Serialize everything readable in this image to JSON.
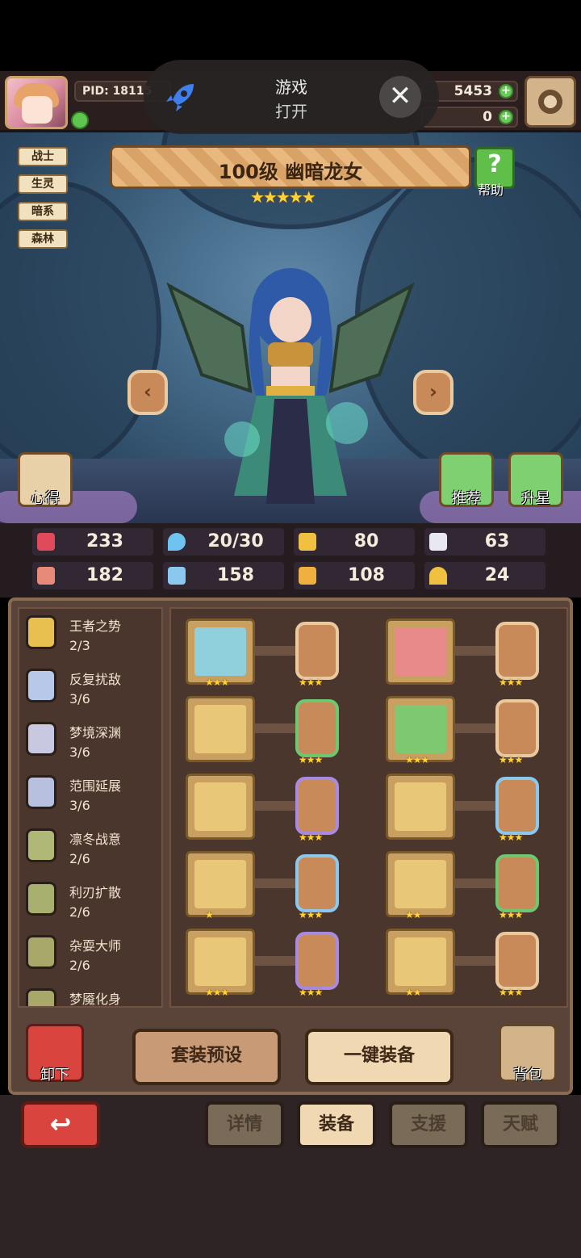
{
  "topbar": {
    "pid": "PID: 18115",
    "currency_gold": "5453",
    "currency_gem": "0",
    "plus_sign": "+"
  },
  "popup": {
    "title": "游戏",
    "subtitle": "打开",
    "close": "✕"
  },
  "hero": {
    "tags": [
      "战士",
      "生灵",
      "暗系",
      "森林"
    ],
    "name": "100级 幽暗龙女",
    "stars": "★★★★★",
    "help_label": "帮助",
    "left_arrow": "‹",
    "right_arrow": "›",
    "notes_label": "心得",
    "recommend_label": "推荐",
    "star_up_label": "升星"
  },
  "stats": [
    {
      "icon": "heart-icon",
      "value": "233",
      "color": "#e04a5a"
    },
    {
      "icon": "water-drop-icon",
      "value": "20/30",
      "color": "#6ec3f0"
    },
    {
      "icon": "shield-icon",
      "value": "80",
      "color": "#f0c040"
    },
    {
      "icon": "wing-icon",
      "value": "63",
      "color": "#e8e8f0"
    },
    {
      "icon": "fist-icon",
      "value": "182",
      "color": "#e88a7a"
    },
    {
      "icon": "book-icon",
      "value": "158",
      "color": "#8ac8f0"
    },
    {
      "icon": "scroll-icon",
      "value": "108",
      "color": "#f0b040"
    },
    {
      "icon": "horseshoe-icon",
      "value": "24",
      "color": "#f0c040"
    }
  ],
  "sets": [
    {
      "name": "王者之势",
      "progress": "2/3",
      "color": "#e8c050"
    },
    {
      "name": "反复扰敌",
      "progress": "3/6",
      "color": "#b8c8e8"
    },
    {
      "name": "梦境深渊",
      "progress": "3/6",
      "color": "#c8c8e0"
    },
    {
      "name": "范围延展",
      "progress": "3/6",
      "color": "#b8c0e0"
    },
    {
      "name": "凛冬战意",
      "progress": "2/6",
      "color": "#b0b878"
    },
    {
      "name": "利刃扩散",
      "progress": "2/6",
      "color": "#a8b070"
    },
    {
      "name": "杂耍大师",
      "progress": "2/6",
      "color": "#a8a868"
    },
    {
      "name": "梦魇化身",
      "progress": "",
      "color": "#a8a868"
    }
  ],
  "equipment": [
    {
      "slot": "sword",
      "stars": "★★★",
      "bg": "#8fd0dc",
      "rune_border": "#e8c9a0",
      "rune_stars": "★★★"
    },
    {
      "slot": "hat",
      "stars": "",
      "bg": "#e88a8a",
      "rune_border": "#e8c9a0",
      "rune_stars": "★★★"
    },
    {
      "slot": "shield",
      "stars": "",
      "bg": "#e8c878",
      "rune_border": "#6ec870",
      "rune_stars": "★★★"
    },
    {
      "slot": "cloak",
      "stars": "★★★",
      "bg": "#7ec870",
      "rune_border": "#e8c9a0",
      "rune_stars": "★★★"
    },
    {
      "slot": "necklace",
      "stars": "",
      "bg": "#e8c878",
      "rune_border": "#a88ae0",
      "rune_stars": "★★★"
    },
    {
      "slot": "armor",
      "stars": "",
      "bg": "#e8c878",
      "rune_border": "#8ac8f0",
      "rune_stars": "★★★"
    },
    {
      "slot": "wings",
      "stars": "★",
      "bg": "#e8c878",
      "rune_border": "#8ac8f0",
      "rune_stars": "★★★"
    },
    {
      "slot": "ring",
      "stars": "★★",
      "bg": "#e8c878",
      "rune_border": "#6ec870",
      "rune_stars": "★★★"
    },
    {
      "slot": "belt",
      "stars": "★★★",
      "bg": "#e8c878",
      "rune_border": "#a88ae0",
      "rune_stars": "★★★"
    },
    {
      "slot": "boots",
      "stars": "★★",
      "bg": "#e8c878",
      "rune_border": "#e8c9a0",
      "rune_stars": "★★★"
    }
  ],
  "actions": {
    "unequip_label": "卸下",
    "preset_label": "套装预设",
    "equip_all_label": "一键装备",
    "bag_label": "背包"
  },
  "tabs": [
    {
      "label": "详情",
      "active": false
    },
    {
      "label": "装备",
      "active": true
    },
    {
      "label": "支援",
      "active": false
    },
    {
      "label": "天赋",
      "active": false
    }
  ],
  "back_symbol": "↩"
}
